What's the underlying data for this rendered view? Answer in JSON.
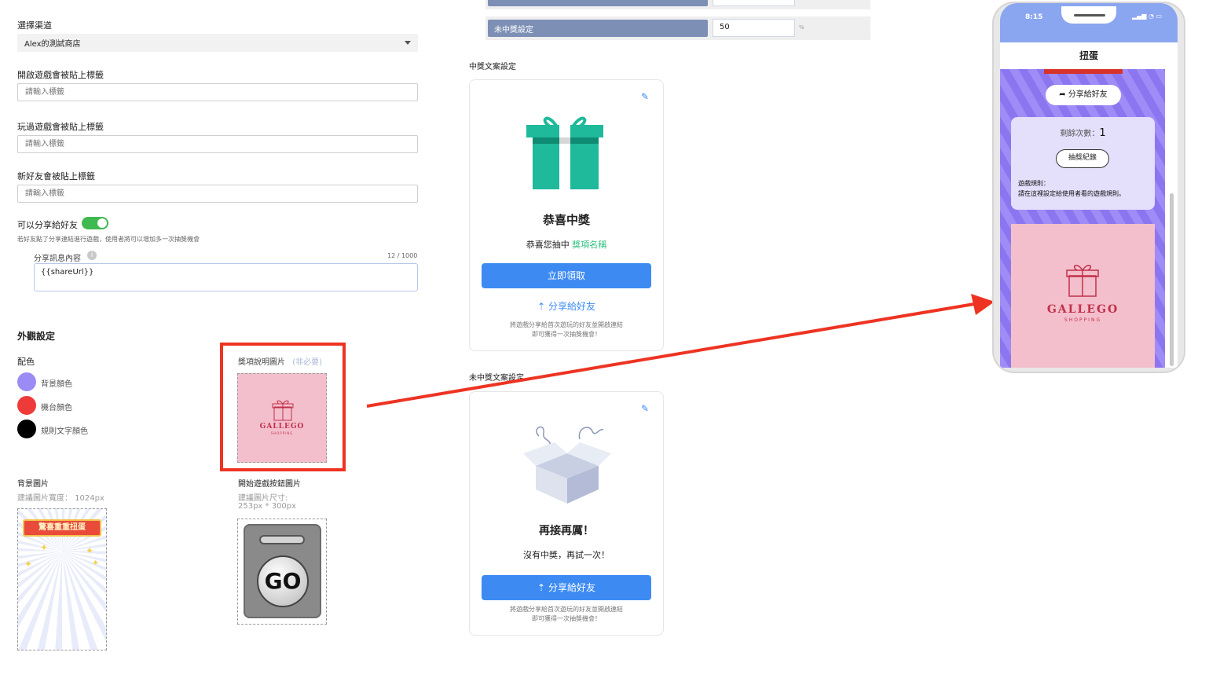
{
  "left": {
    "channel_label": "選擇渠道",
    "channel_value": "Alex的測試商店",
    "open_tag_label": "開啟遊戲會被貼上標籤",
    "open_tag_placeholder": "請輸入標籤",
    "played_tag_label": "玩過遊戲會被貼上標籤",
    "played_tag_placeholder": "請輸入標籤",
    "newfriend_tag_label": "新好友會被貼上標籤",
    "newfriend_tag_placeholder": "請輸入標籤",
    "share_toggle_label": "可以分享給好友",
    "share_toggle_on": true,
    "share_hint": "若好友點了分享連結進行遊戲，使用者將可以增加多一次抽獎機會",
    "share_msg_label": "分享訊息內容",
    "share_msg_count": "12 / 1000",
    "share_msg_value": "{{shareUrl}}"
  },
  "appearance": {
    "title": "外觀設定",
    "palette_label": "配色",
    "colors": [
      {
        "label": "背景顏色",
        "color": "#9b8cf5"
      },
      {
        "label": "機台顏色",
        "color": "#ef3a3a"
      },
      {
        "label": "規則文字顏色",
        "color": "#000000"
      }
    ],
    "prize_img_label": "獎項說明圖片",
    "prize_img_optional": "(非必要)",
    "bg_img_label": "背景圖片",
    "bg_img_hint": "建議圖片寬度： 1024px",
    "bg_banner_text": "驚喜重重扭蛋",
    "start_btn_label": "開始遊戲按鈕圖片",
    "start_btn_hint1": "建議圖片尺寸:",
    "start_btn_hint2": "253px * 300px",
    "go_text": "GO",
    "gallego_main": "GALLEGO",
    "gallego_sub": "SHOPPING"
  },
  "middle": {
    "rate_input_value": "50",
    "rate_unit": "%",
    "no_prize_label": "未中獎設定",
    "no_prize_value": "50",
    "win_section_label": "中獎文案設定",
    "win_title": "恭喜中獎",
    "win_line_prefix": "恭喜您抽中",
    "win_line_prize": "獎項名稱",
    "win_claim_btn": "立即領取",
    "win_share": "分享給好友",
    "win_tip1": "將遊戲分享給首次遊玩的好友並開啟連結",
    "win_tip2": "即可獲得一次抽獎機會！",
    "lose_section_label": "未中獎文案設定",
    "lose_title": "再接再厲！",
    "lose_line": "沒有中獎，再試一次！",
    "lose_share_btn": "分享給好友",
    "lose_tip1": "將遊戲分享給首次遊玩的好友並開啟連結",
    "lose_tip2": "即可獲得一次抽獎機會！"
  },
  "phone": {
    "time": "8:15",
    "title": "扭蛋",
    "share_btn": "分享給好友",
    "remaining_label": "剩餘次數：",
    "remaining_value": "1",
    "record_btn": "抽獎紀錄",
    "rules_title": "遊戲規則：",
    "rules_text": "請在這裡設定給使用者看的遊戲規則。",
    "gallego_main": "GALLEGO",
    "gallego_sub": "SHOPPING"
  },
  "colors": {
    "accent_blue": "#3d8bf2",
    "arrow_red": "#ee3322",
    "toggle_green": "#3fb950",
    "prize_green": "#2ec27e"
  }
}
